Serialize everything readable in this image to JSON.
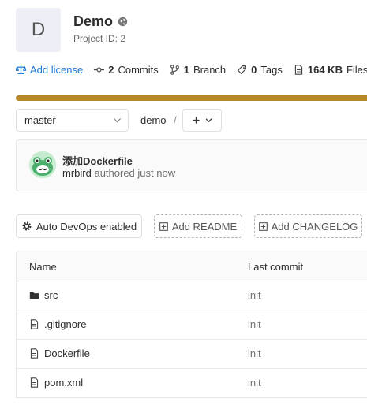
{
  "project": {
    "avatar_letter": "D",
    "name": "Demo",
    "id_text": "Project ID: 2"
  },
  "stats": {
    "license_label": "Add license",
    "commits_count": "2",
    "commits_label": "Commits",
    "branches_count": "1",
    "branches_label": "Branch",
    "tags_count": "0",
    "tags_label": "Tags",
    "files_size": "164 KB",
    "files_label": "Files"
  },
  "repo": {
    "branch": "master",
    "path": "demo",
    "separator": "/"
  },
  "commit": {
    "title": "添加Dockerfile",
    "author": "mrbird",
    "meta": "authored just now"
  },
  "actions": {
    "devops": "Auto DevOps enabled",
    "readme": "Add README",
    "changelog": "Add CHANGELOG"
  },
  "table": {
    "headers": {
      "name": "Name",
      "last_commit": "Last commit"
    },
    "rows": [
      {
        "name": "src",
        "icon": "folder-icon",
        "commit": "init"
      },
      {
        "name": ".gitignore",
        "icon": "file-icon",
        "commit": "init"
      },
      {
        "name": "Dockerfile",
        "icon": "file-icon",
        "commit": "init"
      },
      {
        "name": "pom.xml",
        "icon": "file-icon",
        "commit": "init"
      }
    ]
  },
  "colors": {
    "link": "#1f78d1",
    "language_bar": "#b8872a"
  }
}
